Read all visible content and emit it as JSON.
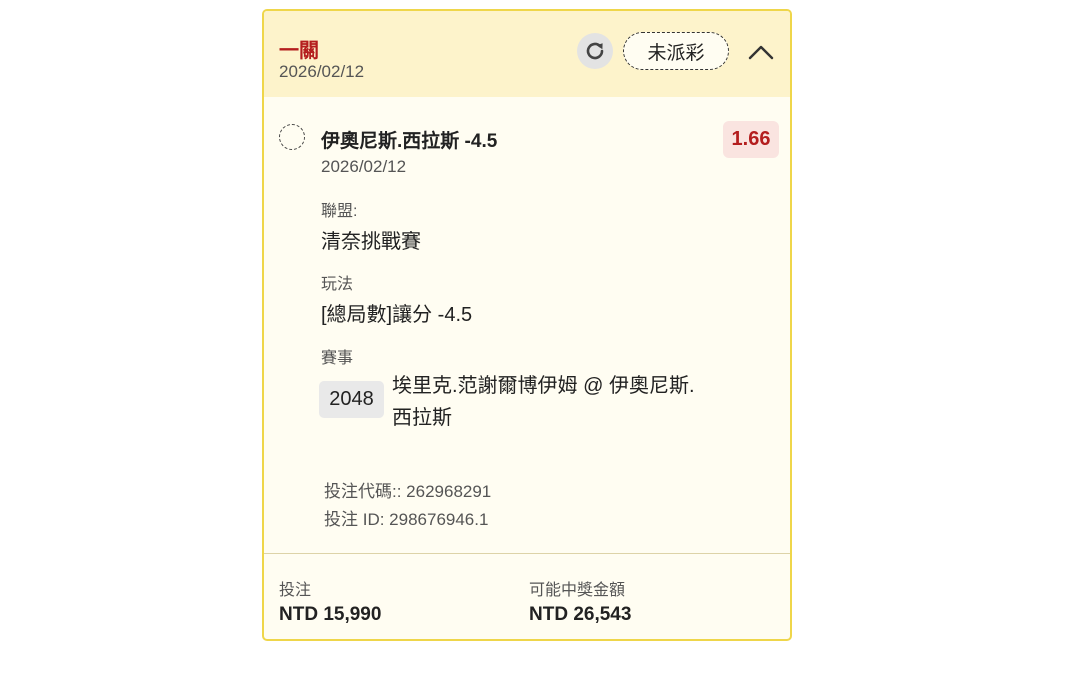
{
  "header": {
    "title": "一關",
    "date": "2026/02/12",
    "status": "未派彩"
  },
  "icons": {
    "refresh": "refresh-icon",
    "collapse": "chevron-up-icon",
    "radio": "radio-icon"
  },
  "selection": {
    "name": "伊奧尼斯.西拉斯 -4.5",
    "date": "2026/02/12",
    "odds": "1.66",
    "league_label": "聯盟:",
    "league": "清奈挑戰賽",
    "market_label": "玩法",
    "market": "[總局數]讓分 -4.5",
    "event_label": "賽事",
    "event_number": "2048",
    "event_name": "埃里克.范謝爾博伊姆 @ 伊奧尼斯.西拉斯"
  },
  "bet": {
    "code": "投注代碼:: 262968291",
    "id": "投注 ID: 298676946.1"
  },
  "footer": {
    "stake_label": "投注",
    "stake_value": "NTD 15,990",
    "payout_label": "可能中獎金額",
    "payout_value": "NTD 26,543"
  },
  "colors": {
    "accent": "#b41e1e",
    "border": "#efd64a",
    "header_bg": "#fdf3cb",
    "card_bg": "#fffdf2"
  }
}
